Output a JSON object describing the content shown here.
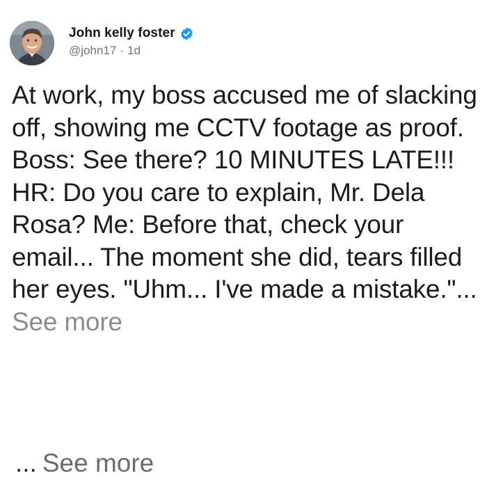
{
  "post": {
    "author": {
      "display_name": "John kelly foster",
      "handle": "@john17",
      "separator": "·",
      "time_ago": "1d",
      "verified_icon": "verified-badge-icon",
      "avatar": "profile-photo"
    },
    "body": "At work, my boss accused me of slacking off, showing me CCTV footage as proof. Boss: See there? 10 MINUTES LATE!!! HR: Do you care to explain, Mr. Dela Rosa? Me: Before that, check your email... The moment she did, tears filled her eyes. \"Uhm... I've made a mistake.\"...",
    "inline_see_more": "See more",
    "footer": {
      "ellipsis": "...",
      "see_more": "See more"
    }
  },
  "colors": {
    "verified_blue": "#1d9bf0",
    "secondary_text": "#657786",
    "see_more_gray": "#8a8d91"
  }
}
